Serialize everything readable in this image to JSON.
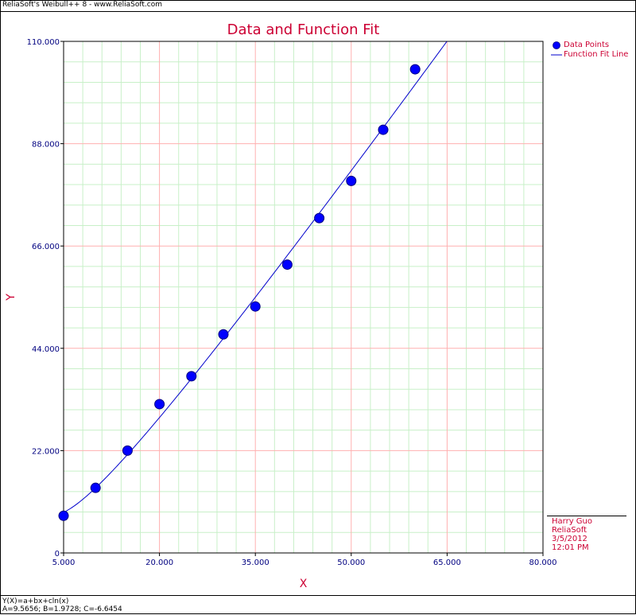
{
  "window": {
    "caption": "ReliaSoft's Weibull++ 8 - www.ReliaSoft.com"
  },
  "chart_data": {
    "type": "scatter",
    "title": "Data and Function Fit",
    "xlabel": "X",
    "ylabel": "Y",
    "xlim": [
      5,
      80
    ],
    "ylim": [
      0,
      110
    ],
    "x_ticks": [
      "5.000",
      "20.000",
      "35.000",
      "50.000",
      "65.000",
      "80.000"
    ],
    "y_ticks": [
      "0",
      "22.000",
      "44.000",
      "66.000",
      "88.000",
      "110.000"
    ],
    "grid": true,
    "legend_position": "right",
    "series": [
      {
        "name": "Data Points",
        "type": "scatter",
        "color": "#0000ff",
        "x": [
          5,
          10,
          15,
          20,
          25,
          30,
          35,
          40,
          45,
          50,
          55,
          60
        ],
        "y": [
          8,
          14,
          22,
          32,
          38,
          47,
          53,
          62,
          72,
          80,
          91,
          104
        ]
      },
      {
        "name": "Function Fit Line",
        "type": "line",
        "color": "#0000cc",
        "function": {
          "A": 9.5656,
          "B": 1.9728,
          "C": -6.6454
        }
      }
    ],
    "colors": {
      "title": "#cc0033",
      "axis_text": "#000080",
      "major_grid": "#ffb0b0",
      "minor_grid": "#c8f0c8"
    }
  },
  "footer": {
    "equation": "Y(X)=a+bx+cln(x)",
    "parameters": "A=9.5656; B=1.9728; C=-6.6454"
  },
  "signature": {
    "name": "Harry Guo",
    "company": "ReliaSoft",
    "date": "3/5/2012",
    "time": "12:01 PM"
  }
}
